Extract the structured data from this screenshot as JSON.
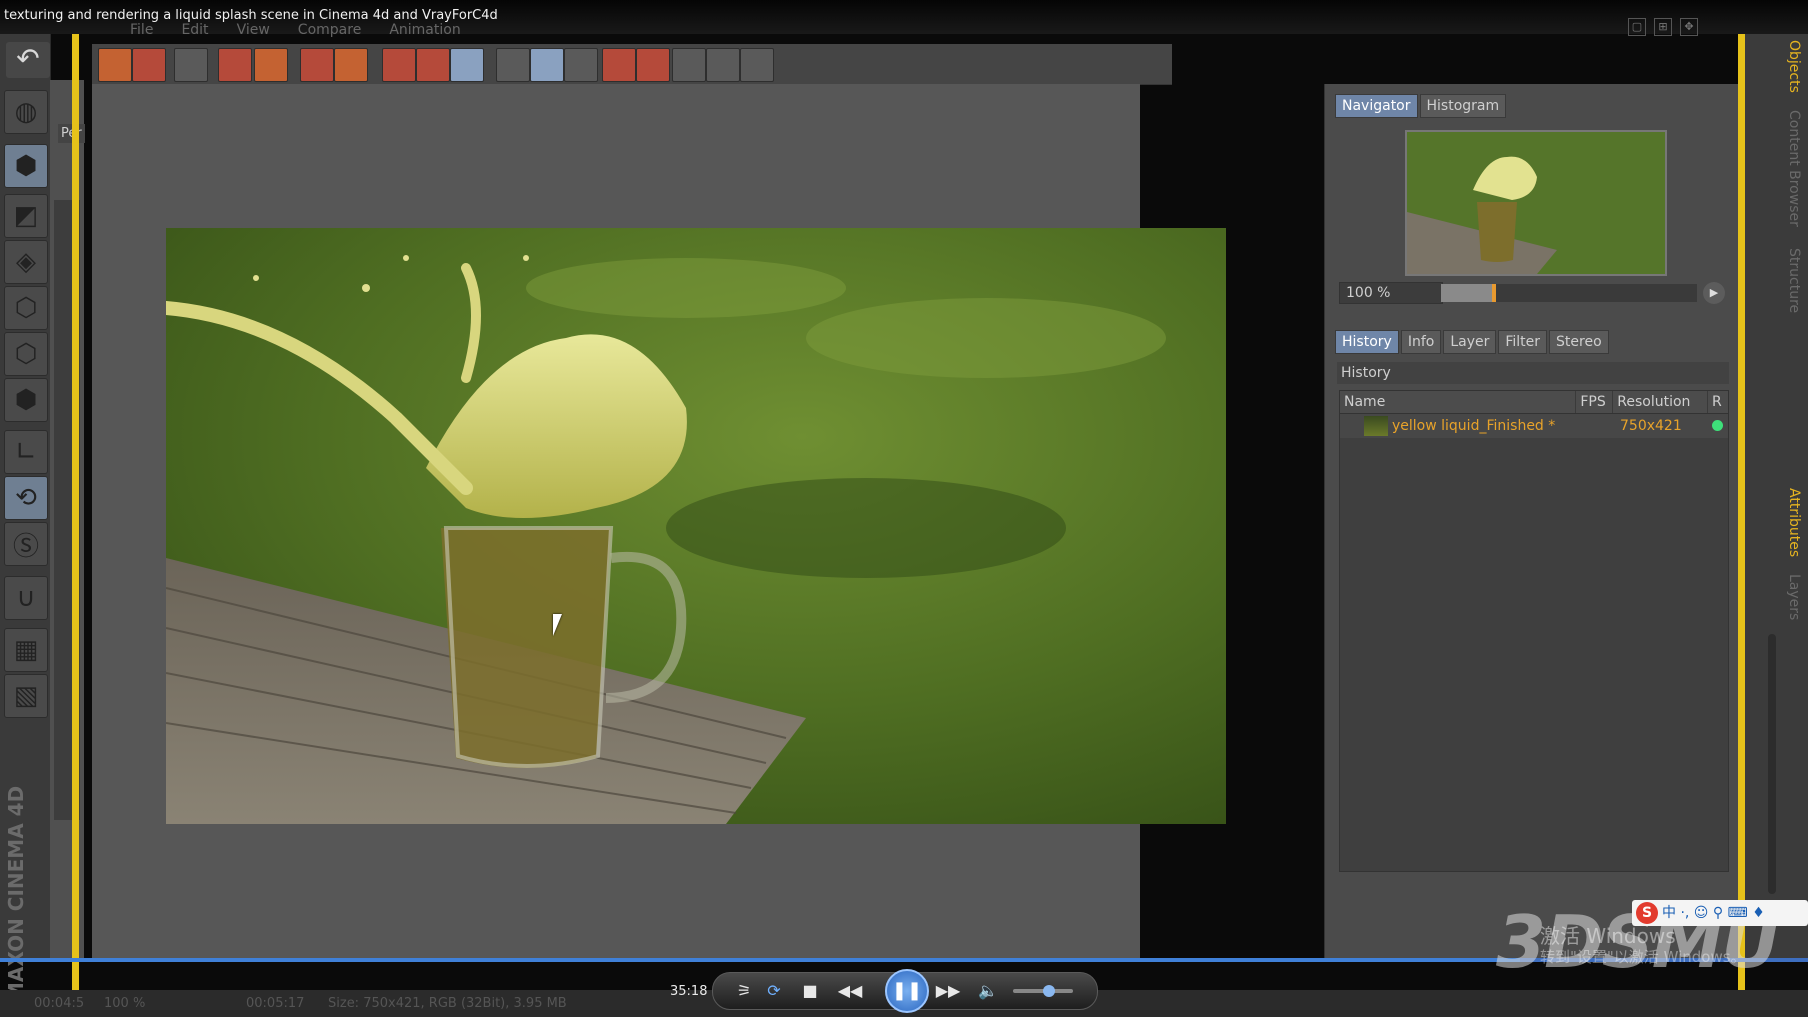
{
  "video": {
    "title": "texturing and rendering a liquid splash scene in Cinema 4d and VrayForC4d",
    "elapsed": "35:18"
  },
  "app": {
    "brand": "MAXON CINEMA 4D",
    "menu": [
      "File",
      "Edit",
      "View",
      "Compare",
      "Animation"
    ],
    "viewport_label": "Per"
  },
  "viewer": {
    "image_alt": "yellow liquid splash from a glass mug on a wooden table over grass"
  },
  "right_panel": {
    "top_tabs": [
      "Navigator",
      "Histogram"
    ],
    "zoom_value": "100 %",
    "zoom_fraction": 0.2,
    "lower_tabs": [
      "History",
      "Info",
      "Layer",
      "Filter",
      "Stereo"
    ],
    "section_title": "History",
    "table": {
      "headers": [
        "Name",
        "FPS",
        "Resolution",
        "R"
      ],
      "rows": [
        {
          "name": "yellow liquid_Finished *",
          "fps": "",
          "resolution": "750x421"
        }
      ]
    }
  },
  "side_tabs": [
    "Objects",
    "Content Browser",
    "Structure",
    "Attributes",
    "Layers"
  ],
  "status_bar": {
    "time_left": "00:04:5",
    "zoom": "100 %",
    "time_right": "00:05:17",
    "info": "Size: 750x421, RGB (32Bit), 3.95 MB"
  },
  "overlays": {
    "watermark": "3DSMU",
    "windows_activate_line1": "激活 Windows",
    "windows_activate_line2": "转到\"设置\"以激活 Windows。",
    "ime": "中 ·, ☺ ⚲ ⌨ ♦"
  },
  "colors": {
    "accent_yellow": "#e6c21a",
    "active_tab": "#6f86a8",
    "history_text": "#e8a32a",
    "status_dot": "#3ee07a"
  }
}
